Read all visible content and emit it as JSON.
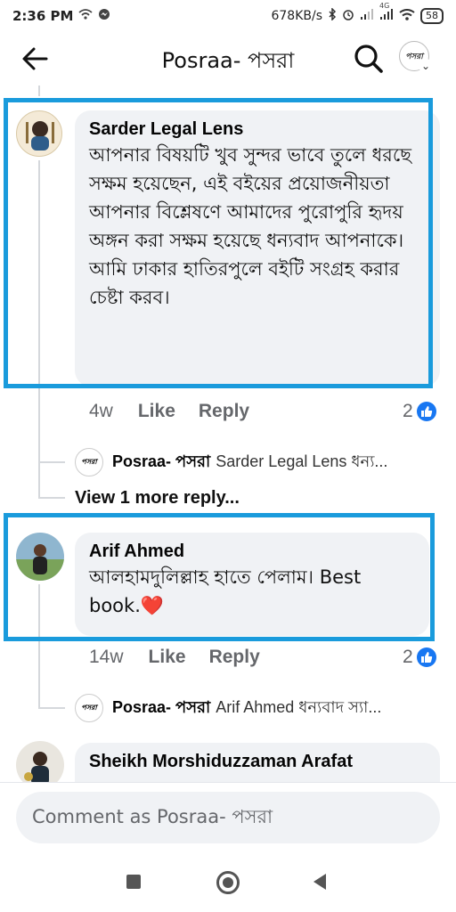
{
  "status_bar": {
    "time": "2:36 PM",
    "network_speed": "678KB/s",
    "battery": "58",
    "icons": [
      "wifi-icon",
      "messenger-icon",
      "bluetooth-icon",
      "alarm-icon",
      "signal-icon",
      "4g-signal-icon",
      "wifi-icon"
    ],
    "network_type": "4G"
  },
  "header": {
    "title": "Posraa- পসরা",
    "back_icon": "arrow-left-icon",
    "search_icon": "search-icon",
    "avatar_text": "পসরা",
    "chevron": "⌄"
  },
  "comments": [
    {
      "author": "Sarder Legal Lens",
      "text": "আপনার বিষয়টি খুব সুন্দর ভাবে তুলে ধরছে সক্ষম হয়েছেন, এই বইয়ের প্রয়োজনীয়তা আপনার বিশ্লেষণে আমাদের পুরোপুরি হৃদয় অঙ্গন করা সক্ষম হয়েছে ধন্যবাদ আপনাকে। আমি ঢাকার হাতিরপুলে বইটি সংগ্রহ করার চেষ্টা করব।",
      "time": "4w",
      "like_label": "Like",
      "reply_label": "Reply",
      "reaction_count": "2",
      "reply": {
        "author": "Posraa- পসরা",
        "snippet": "Sarder Legal Lens ধন্য...",
        "avatar_text": "পসরা"
      },
      "view_more": "View 1 more reply..."
    },
    {
      "author": "Arif Ahmed",
      "text": "আলহামদুলিল্লাহ হাতে পেলাম। Best book.",
      "emoji": "❤️",
      "time": "14w",
      "like_label": "Like",
      "reply_label": "Reply",
      "reaction_count": "2",
      "reply": {
        "author": "Posraa- পসরা",
        "snippet": "Arif Ahmed ধন্যবাদ স্যা...",
        "avatar_text": "পসরা"
      }
    },
    {
      "author": "Sheikh Morshiduzzaman Arafat"
    }
  ],
  "composer": {
    "placeholder": "Comment as Posraa- পসরা"
  },
  "colors": {
    "highlight": "#1a9bdc",
    "like_blue": "#1877f2",
    "bubble_bg": "#f0f2f5",
    "heart": "#e0242f"
  }
}
